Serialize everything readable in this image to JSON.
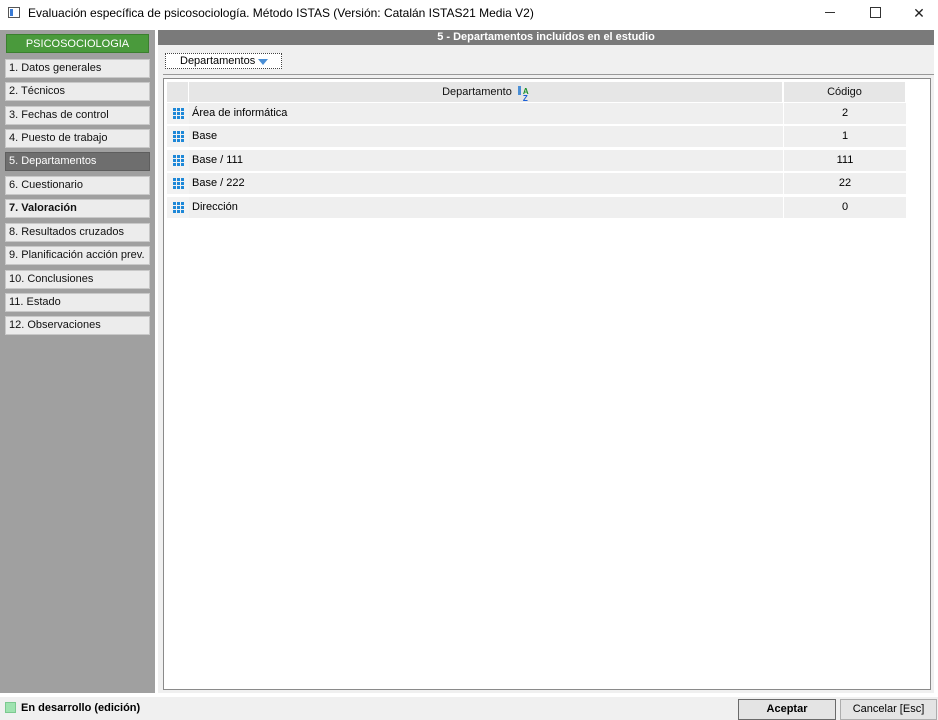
{
  "window": {
    "title": "Evaluación específica de psicosociología. Método ISTAS (Versión: Catalán ISTAS21 Media V2)"
  },
  "sidebar": {
    "header": "PSICOSOCIOLOGIA",
    "items": [
      {
        "label": "1. Datos generales"
      },
      {
        "label": "2. Técnicos"
      },
      {
        "label": "3. Fechas de control"
      },
      {
        "label": "4. Puesto de trabajo"
      },
      {
        "label": "5. Departamentos",
        "active": true
      },
      {
        "label": "6. Cuestionario"
      },
      {
        "label": "7. Valoración",
        "bold": true
      },
      {
        "label": "8. Resultados cruzados"
      },
      {
        "label": "9. Planificación acción prev."
      },
      {
        "label": "10. Conclusiones"
      },
      {
        "label": "11. Estado"
      },
      {
        "label": "12. Observaciones"
      }
    ]
  },
  "main": {
    "header": "5 - Departamentos incluídos en el estudio",
    "dropdown_label": "Departamentos",
    "grid": {
      "columns": {
        "department": "Departamento",
        "code": "Código"
      },
      "rows": [
        {
          "department": "Área de informática",
          "code": "2"
        },
        {
          "department": "Base",
          "code": "1"
        },
        {
          "department": "Base / 111",
          "code": "111"
        },
        {
          "department": "Base / 222",
          "code": "22"
        },
        {
          "department": "Dirección",
          "code": "0"
        }
      ]
    }
  },
  "status": {
    "text": "En desarrollo (edición)",
    "led_color": "#9fe3b0"
  },
  "buttons": {
    "accept": "Aceptar",
    "cancel": "Cancelar [Esc]"
  },
  "colors": {
    "sidebar_header": "#4a9a3c",
    "active_item": "#6e6e6e",
    "row_icon": "#1e88d8"
  }
}
